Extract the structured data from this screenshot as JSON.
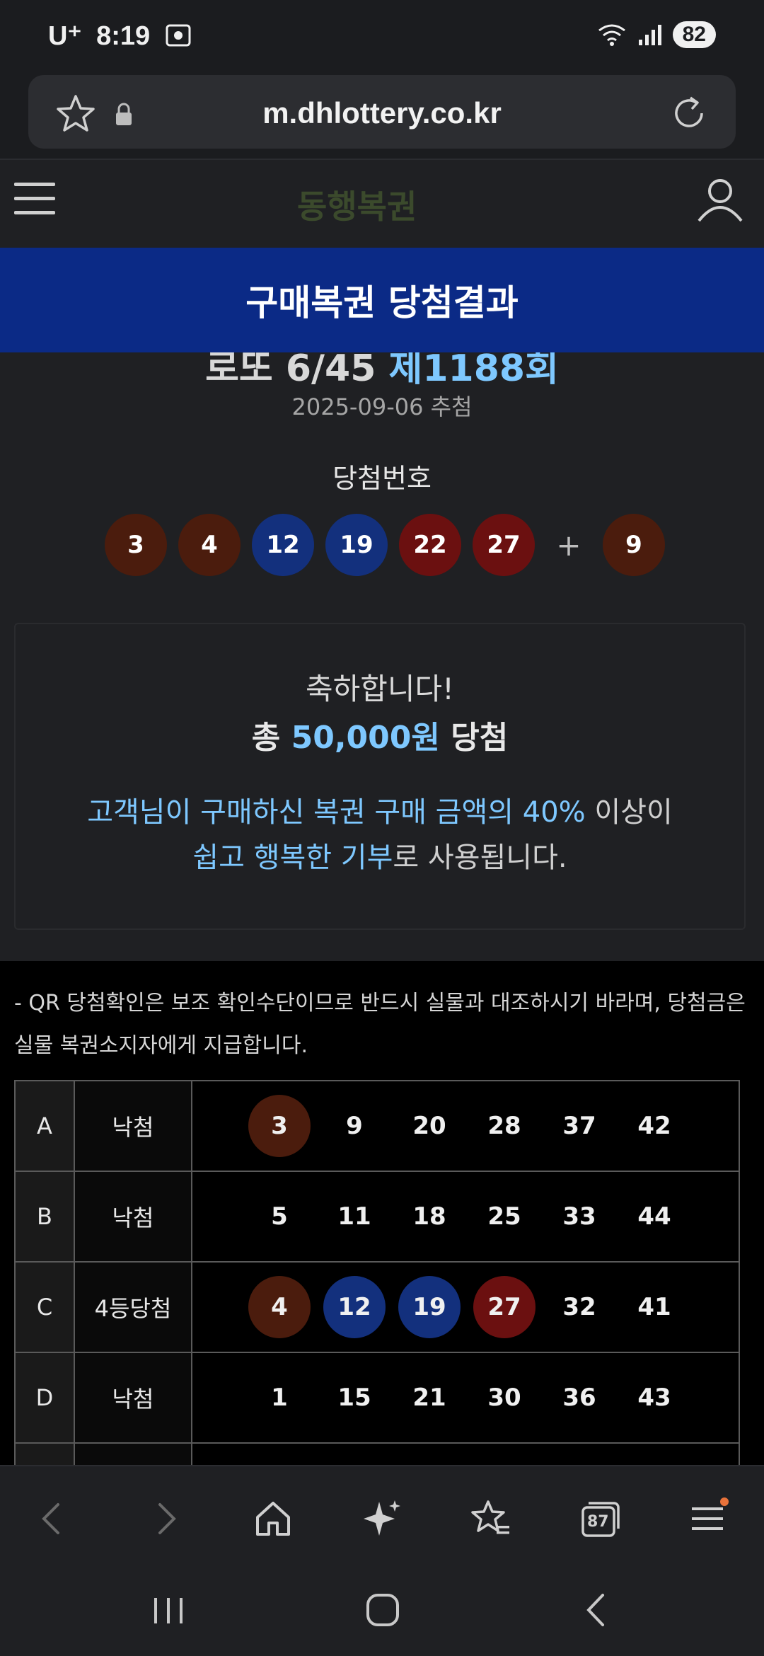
{
  "status_bar": {
    "carrier": "U⁺",
    "time": "8:19",
    "battery": "82"
  },
  "url_bar": {
    "url": "m.dhlottery.co.kr"
  },
  "site": {
    "logo": "동행복권"
  },
  "banner": {
    "title": "구매복권 당첨결과"
  },
  "draw": {
    "game": "로또 6/45",
    "round": "제1188회",
    "date": "2025-09-06 추첨",
    "winning_label": "당첨번호",
    "numbers": [
      "3",
      "4",
      "12",
      "19",
      "22",
      "27"
    ],
    "plus": "+",
    "bonus": "9"
  },
  "result": {
    "congrats": "축하합니다!",
    "prize_prefix": "총",
    "prize_amount": "50,000원",
    "prize_suffix": "당첨",
    "donate_line1_a": "고객님이 구매하신 복권 구매 금액의 40%",
    "donate_line1_b": "이상이",
    "donate_line2_a": "쉽고 행복한 기부",
    "donate_line2_b": "로 사용됩니다."
  },
  "notice": "- QR 당첨확인은 보조 확인수단이므로 반드시 실물과 대조하시기 바라며, 당첨금은 실물 복권소지자에게 지급합니다.",
  "tickets": [
    {
      "game": "A",
      "status": "낙첨",
      "numbers": [
        "3",
        "9",
        "20",
        "28",
        "37",
        "42"
      ]
    },
    {
      "game": "B",
      "status": "낙첨",
      "numbers": [
        "5",
        "11",
        "18",
        "25",
        "33",
        "44"
      ]
    },
    {
      "game": "C",
      "status": "4등당첨",
      "numbers": [
        "4",
        "12",
        "19",
        "27",
        "32",
        "41"
      ]
    },
    {
      "game": "D",
      "status": "낙첨",
      "numbers": [
        "1",
        "15",
        "21",
        "30",
        "36",
        "43"
      ]
    }
  ],
  "bottom_bar": {
    "tabs_count": "87"
  },
  "colors": {
    "banner": "#0b2a86",
    "accent_blue": "#7ec8ff",
    "ball_brown": "#4b1c0d",
    "ball_blue": "#13307d",
    "ball_red": "#6b1010"
  }
}
